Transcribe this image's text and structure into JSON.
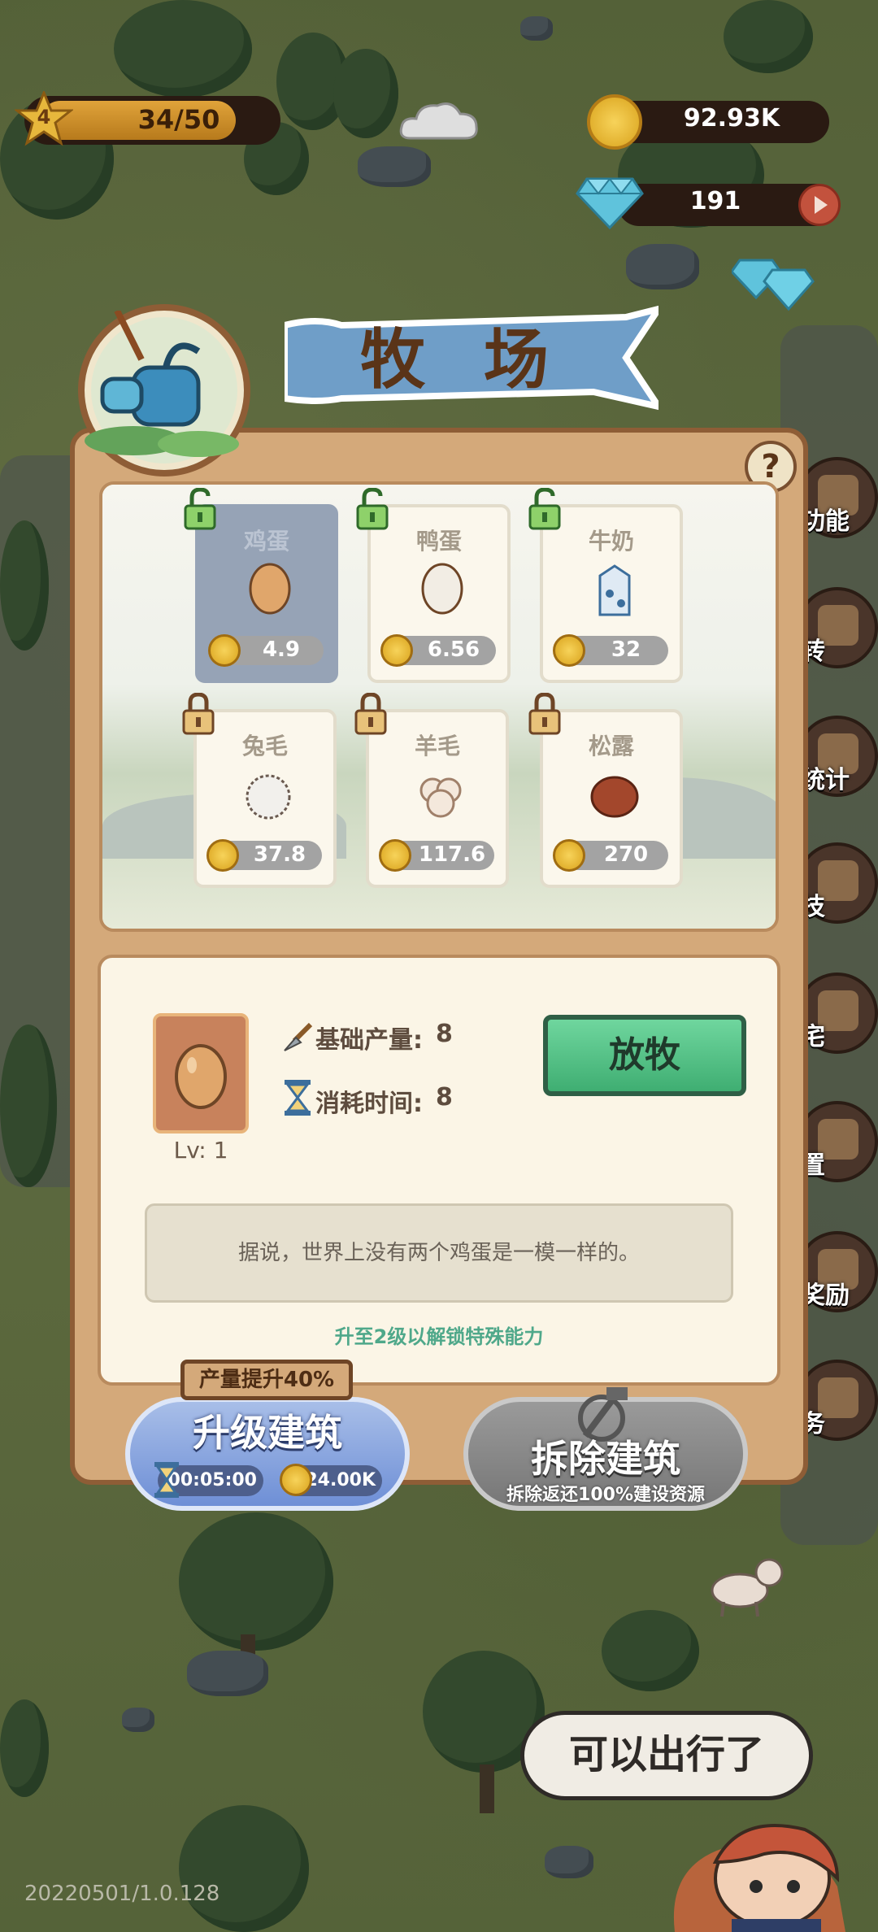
{
  "hud": {
    "level": "4",
    "exp": "34/50",
    "coins": "92.93K",
    "gems": "191"
  },
  "side_menu": [
    {
      "label": "功能",
      "icon": "function-icon"
    },
    {
      "label": "转",
      "icon": "book-icon"
    },
    {
      "label": "统计",
      "icon": "stats-icon"
    },
    {
      "label": "技",
      "icon": "potion-icon"
    },
    {
      "label": "宅",
      "icon": "wrench-icon"
    },
    {
      "label": "置",
      "icon": "gear-icon"
    },
    {
      "label": "奖励",
      "icon": "character-icon"
    },
    {
      "label": "务",
      "icon": "star-icon"
    }
  ],
  "panel": {
    "title": "牧 场",
    "help": "?",
    "products": [
      {
        "name": "鸡蛋",
        "price": "4.9",
        "icon": "egg-icon",
        "lock": "unlocked",
        "selected": true
      },
      {
        "name": "鸭蛋",
        "price": "6.56",
        "icon": "duck-egg-icon",
        "lock": "unlocked",
        "selected": false
      },
      {
        "name": "牛奶",
        "price": "32",
        "icon": "milk-icon",
        "lock": "unlocked",
        "selected": false
      },
      {
        "name": "兔毛",
        "price": "37.8",
        "icon": "rabbit-fur-icon",
        "lock": "locked",
        "selected": false
      },
      {
        "name": "羊毛",
        "price": "117.6",
        "icon": "wool-icon",
        "lock": "locked",
        "selected": false
      },
      {
        "name": "松露",
        "price": "270",
        "icon": "truffle-icon",
        "lock": "locked",
        "selected": false
      }
    ],
    "detail": {
      "level": "Lv: 1",
      "base_output_label": "基础产量:",
      "base_output": "8",
      "time_label": "消耗时间:",
      "time": "8",
      "graze_button": "放牧",
      "description": "据说，世界上没有两个鸡蛋是一模一样的。",
      "unlock_tip": "升至2级以解锁特殊能力"
    }
  },
  "actions": {
    "boost_tag": "产量提升40%",
    "upgrade_label": "升级建筑",
    "upgrade_time": "00:05:00",
    "upgrade_cost": "24.00K",
    "demolish_label": "拆除建筑",
    "demolish_sub": "拆除返还100%建设资源"
  },
  "speech": "可以出行了",
  "version": "20220501/1.0.128",
  "colors": {
    "panel": "#d4a97a",
    "graze": "#4fc585",
    "upgrade": "#7f9edc",
    "demolish": "#8a8a8a"
  }
}
